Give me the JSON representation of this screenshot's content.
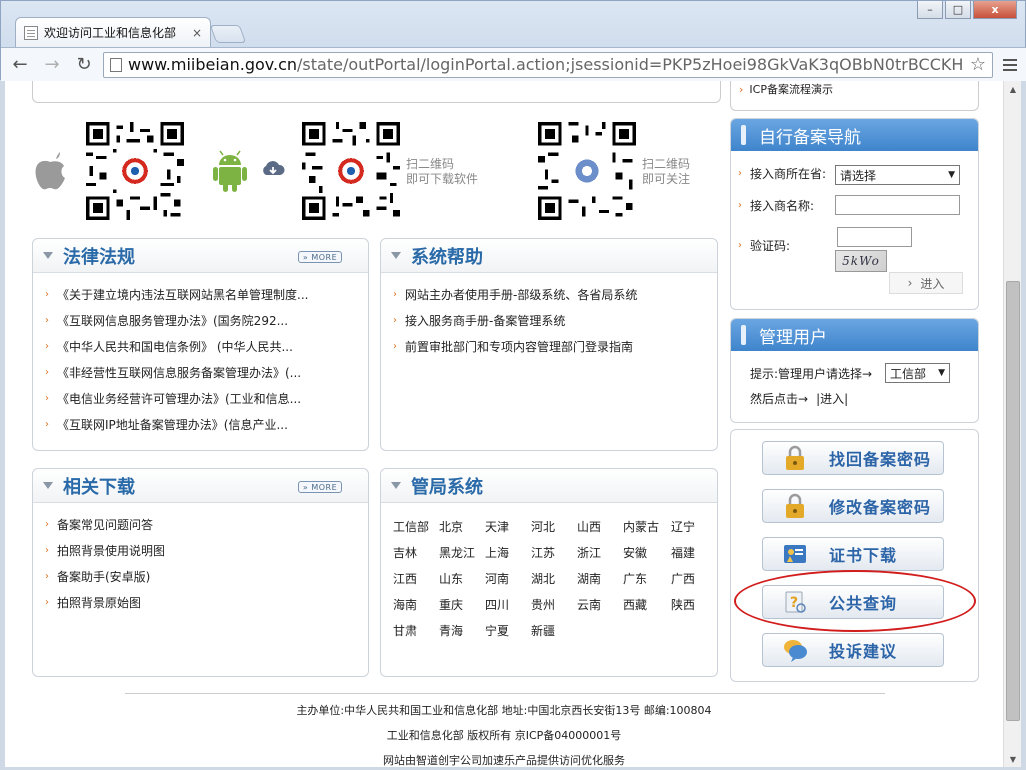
{
  "browser": {
    "tab_title": "欢迎访问工业和信息化部",
    "tab_close": "×",
    "url_host": "www.miibeian.gov.cn",
    "url_path": "/state/outPortal/loginPortal.action;jsessionid=PKP5zHoei98GkVaK3qOBbN0trBCCKHByC",
    "window_buttons": [
      "–",
      "□",
      "x"
    ]
  },
  "top_box": {
    "icp_link": "ICP备案流程演示"
  },
  "qr_section": {
    "caption_download_1": "扫二维码",
    "caption_download_2": "即可下载软件",
    "caption_follow_1": "扫二维码",
    "caption_follow_2": "即可关注"
  },
  "laws_panel": {
    "title": "法律法规",
    "more": "» MORE",
    "items": [
      "《关于建立境内违法互联网站黑名单管理制度...",
      "《互联网信息服务管理办法》(国务院292...",
      "《中华人民共和国电信条例》 (中华人民共...",
      "《非经营性互联网信息服务备案管理办法》(...",
      "《电信业务经营许可管理办法》(工业和信息...",
      "《互联网IP地址备案管理办法》(信息产业..."
    ]
  },
  "help_panel": {
    "title": "系统帮助",
    "items": [
      "网站主办者使用手册-部级系统、各省局系统",
      "接入服务商手册-备案管理系统",
      "前置审批部门和专项内容管理部门登录指南"
    ]
  },
  "downloads_panel": {
    "title": "相关下载",
    "more": "» MORE",
    "items": [
      "备案常见问题问答",
      "拍照背景使用说明图",
      "备案助手(安卓版)",
      "拍照背景原始图"
    ]
  },
  "bureau_panel": {
    "title": "管局系统",
    "regions": [
      "工信部",
      "北京",
      "天津",
      "河北",
      "山西",
      "内蒙古",
      "辽宁",
      "吉林",
      "黑龙江",
      "上海",
      "江苏",
      "浙江",
      "安徽",
      "福建",
      "江西",
      "山东",
      "河南",
      "湖北",
      "湖南",
      "广东",
      "广西",
      "海南",
      "重庆",
      "四川",
      "贵州",
      "云南",
      "西藏",
      "陕西",
      "甘肃",
      "青海",
      "宁夏",
      "新疆"
    ]
  },
  "self_nav": {
    "title": "自行备案导航",
    "isp_location_label": "接入商所在省:",
    "isp_location_value": "请选择",
    "isp_name_label": "接入商名称:",
    "captcha_label": "验证码:",
    "captcha_text": "5kWo",
    "enter_button": "进入"
  },
  "admin_user": {
    "title": "管理用户",
    "hint_label": "提示:管理用户请选择→",
    "select_value": "工信部",
    "then_click": "然后点击→",
    "enter_link": "|进入|"
  },
  "actions": {
    "retrieve_password": "找回备案密码",
    "change_password": "修改备案密码",
    "cert_download": "证书下载",
    "public_query": "公共查询",
    "complaint": "投诉建议"
  },
  "footer": {
    "line1": "主办单位:中华人民共和国工业和信息化部 地址:中国北京西长安街13号 邮编:100804",
    "line2": "工业和信息化部 版权所有 京ICP备04000001号",
    "line3": "网站由智道创宇公司加速乐产品提供访问优化服务"
  },
  "colors": {
    "accent_blue": "#2a6aa8",
    "orange_bullet": "#e07020",
    "highlight_red": "#d21d1d"
  }
}
